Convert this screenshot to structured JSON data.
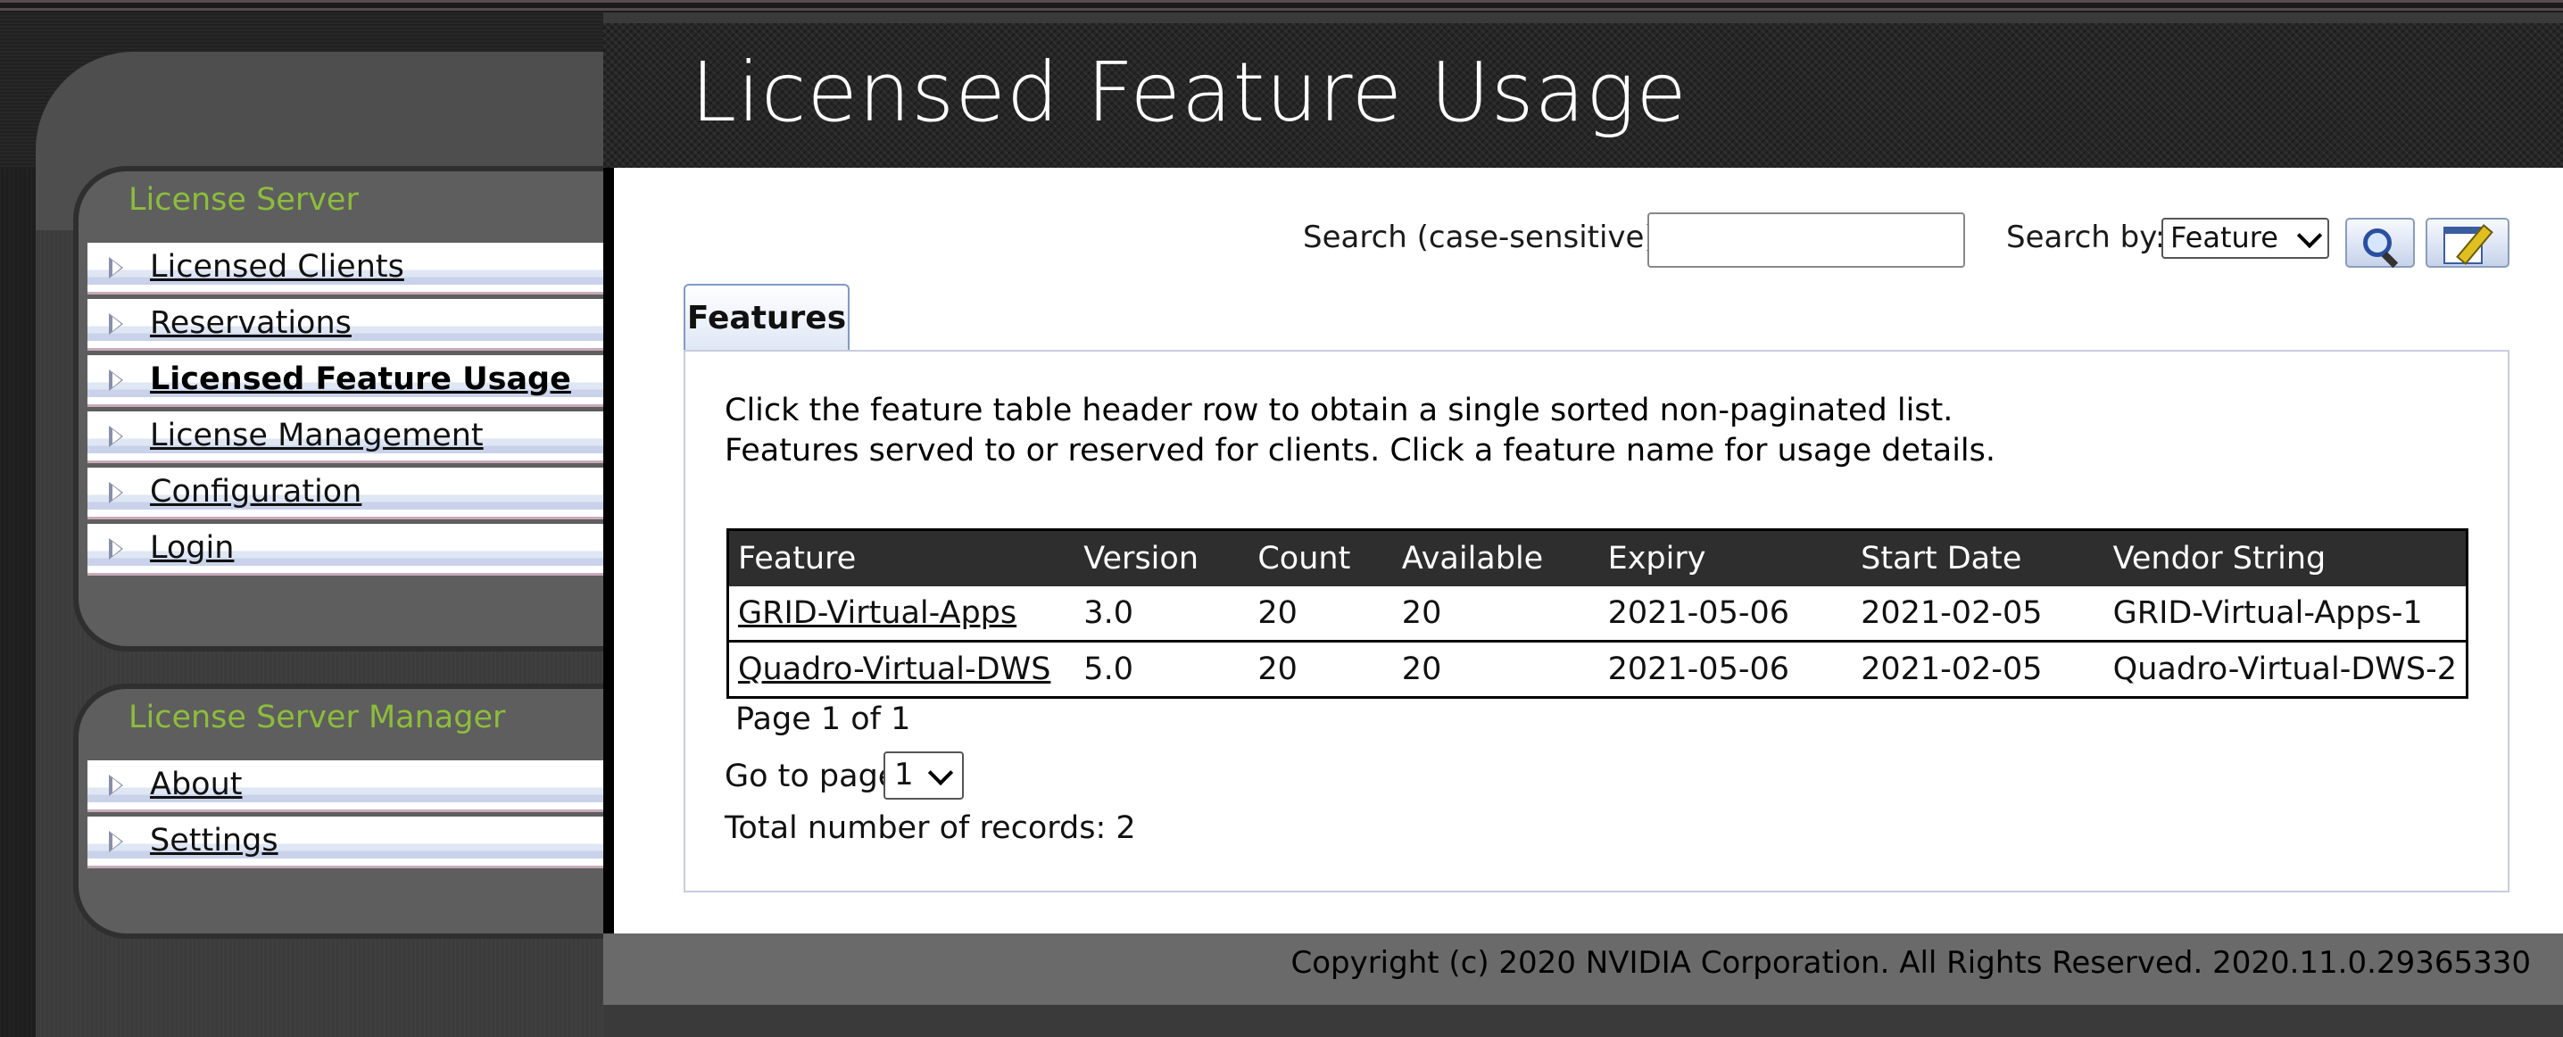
{
  "header": {
    "title": "Licensed Feature Usage"
  },
  "sidebar": {
    "server_section": {
      "title": "License Server",
      "items": [
        {
          "label": "Licensed Clients"
        },
        {
          "label": "Reservations"
        },
        {
          "label": "Licensed Feature Usage",
          "active": true
        },
        {
          "label": "License Management"
        },
        {
          "label": "Configuration"
        },
        {
          "label": "Login"
        }
      ]
    },
    "manager_section": {
      "title": "License Server Manager",
      "items": [
        {
          "label": "About"
        },
        {
          "label": "Settings"
        }
      ]
    }
  },
  "search": {
    "label": "Search (case-sensitive):",
    "value": "",
    "by_label": "Search by:",
    "by_selected": "Feature"
  },
  "tabs": [
    {
      "label": "Features",
      "active": true
    }
  ],
  "info": {
    "line1": "Click the feature table header row to obtain a single sorted non-paginated list.",
    "line2": "Features served to or reserved for clients. Click a feature name for usage details."
  },
  "table": {
    "headers": [
      "Feature",
      "Version",
      "Count",
      "Available",
      "Expiry",
      "Start Date",
      "Vendor String"
    ],
    "rows": [
      [
        "GRID-Virtual-Apps",
        "3.0",
        "20",
        "20",
        "2021-05-06",
        "2021-02-05",
        "GRID-Virtual-Apps-1"
      ],
      [
        "Quadro-Virtual-DWS",
        "5.0",
        "20",
        "20",
        "2021-05-06",
        "2021-02-05",
        "Quadro-Virtual-DWS-2"
      ]
    ]
  },
  "pagination": {
    "page_text": "Page 1 of 1",
    "goto_label": "Go to page",
    "goto_selected": "1",
    "total_text": "Total number of records: 2"
  },
  "footer": {
    "text": "Copyright (c) 2020 NVIDIA Corporation. All Rights Reserved. 2020.11.0.29365330"
  },
  "colors": {
    "accent_green": "#8cbd3b",
    "header_dark": "#2e2e2e",
    "tab_border": "#7f9ac8"
  }
}
